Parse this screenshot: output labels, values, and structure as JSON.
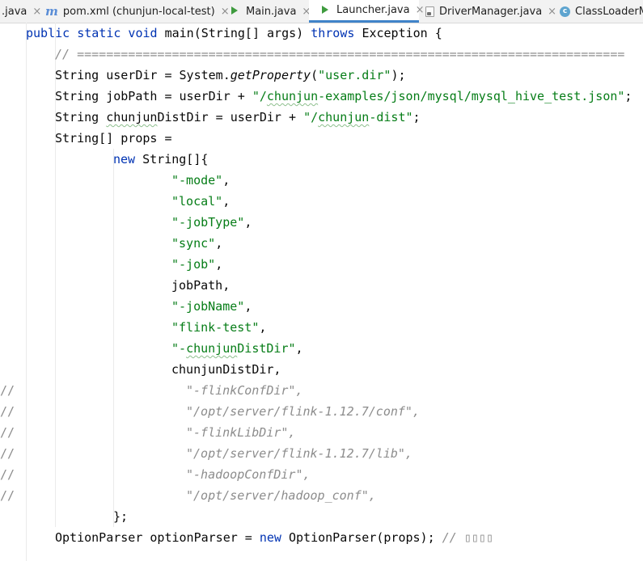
{
  "tabs": [
    {
      "label": ".java",
      "icon": "none",
      "active": false
    },
    {
      "label": "pom.xml (chunjun-local-test)",
      "icon": "maven-icon",
      "active": false
    },
    {
      "label": "Main.java",
      "icon": "run-class-icon",
      "active": false
    },
    {
      "label": "Launcher.java",
      "icon": "run-class-icon",
      "active": true
    },
    {
      "label": "DriverManager.java",
      "icon": "java-file-icon",
      "active": false
    },
    {
      "label": "ClassLoaderMa",
      "icon": "class-icon",
      "active": false
    }
  ],
  "icons": {
    "maven_glyph": "m",
    "class_glyph": "c",
    "close_glyph": "×"
  },
  "code": {
    "line01": {
      "kw1": "public static void",
      "name": "main(String[] args)",
      "kw2": "throws",
      "rest": "Exception {"
    },
    "line02": {
      "comment": "// ==========================================================================="
    },
    "line03": {
      "pre": "String userDir = System.",
      "method": "getProperty",
      "open": "(",
      "str": "\"user.dir\"",
      "close": ");"
    },
    "line04": {
      "pre": "String jobPath = userDir + ",
      "str_a": "\"/",
      "str_typo": "chunjun",
      "str_b": "-examples/json/mysql/mysql_hive_test.json\"",
      "close": ";"
    },
    "line05": {
      "pre1": "String ",
      "var_typo": "chunjun",
      "pre2": "DistDir = userDir + ",
      "str_a": "\"/",
      "str_typo": "chunjun",
      "str_b": "-dist\"",
      "close": ";"
    },
    "line06": {
      "text": "String[] props ="
    },
    "line07": {
      "kw": "new",
      "rest": " String[]{"
    },
    "line08": {
      "str": "\"-mode\"",
      "comma": ","
    },
    "line09": {
      "str": "\"local\"",
      "comma": ","
    },
    "line10": {
      "str": "\"-jobType\"",
      "comma": ","
    },
    "line11": {
      "str": "\"sync\"",
      "comma": ","
    },
    "line12": {
      "str": "\"-job\"",
      "comma": ","
    },
    "line13": {
      "text": "jobPath,"
    },
    "line14": {
      "str": "\"-jobName\"",
      "comma": ","
    },
    "line15": {
      "str": "\"flink-test\"",
      "comma": ","
    },
    "line16": {
      "str_a": "\"-",
      "str_typo": "chunjun",
      "str_b": "DistDir\"",
      "comma": ","
    },
    "line17": {
      "text": "chunjunDistDir,"
    },
    "line18": {
      "slashes": "//",
      "comment": "\"-flinkConfDir\","
    },
    "line19": {
      "slashes": "//",
      "comment": "\"/opt/server/flink-1.12.7/conf\","
    },
    "line20": {
      "slashes": "//",
      "comment": "\"-flinkLibDir\","
    },
    "line21": {
      "slashes": "//",
      "comment": "\"/opt/server/flink-1.12.7/lib\","
    },
    "line22": {
      "slashes": "//",
      "comment": "\"-hadoopConfDir\","
    },
    "line23": {
      "slashes": "//",
      "comment": "\"/opt/server/hadoop_conf\","
    },
    "line24": {
      "text": "};"
    },
    "line25": {
      "pre": "OptionParser optionParser = ",
      "kw": "new",
      "rest": " OptionParser(props); ",
      "comment": "// ▯▯▯▯"
    }
  }
}
